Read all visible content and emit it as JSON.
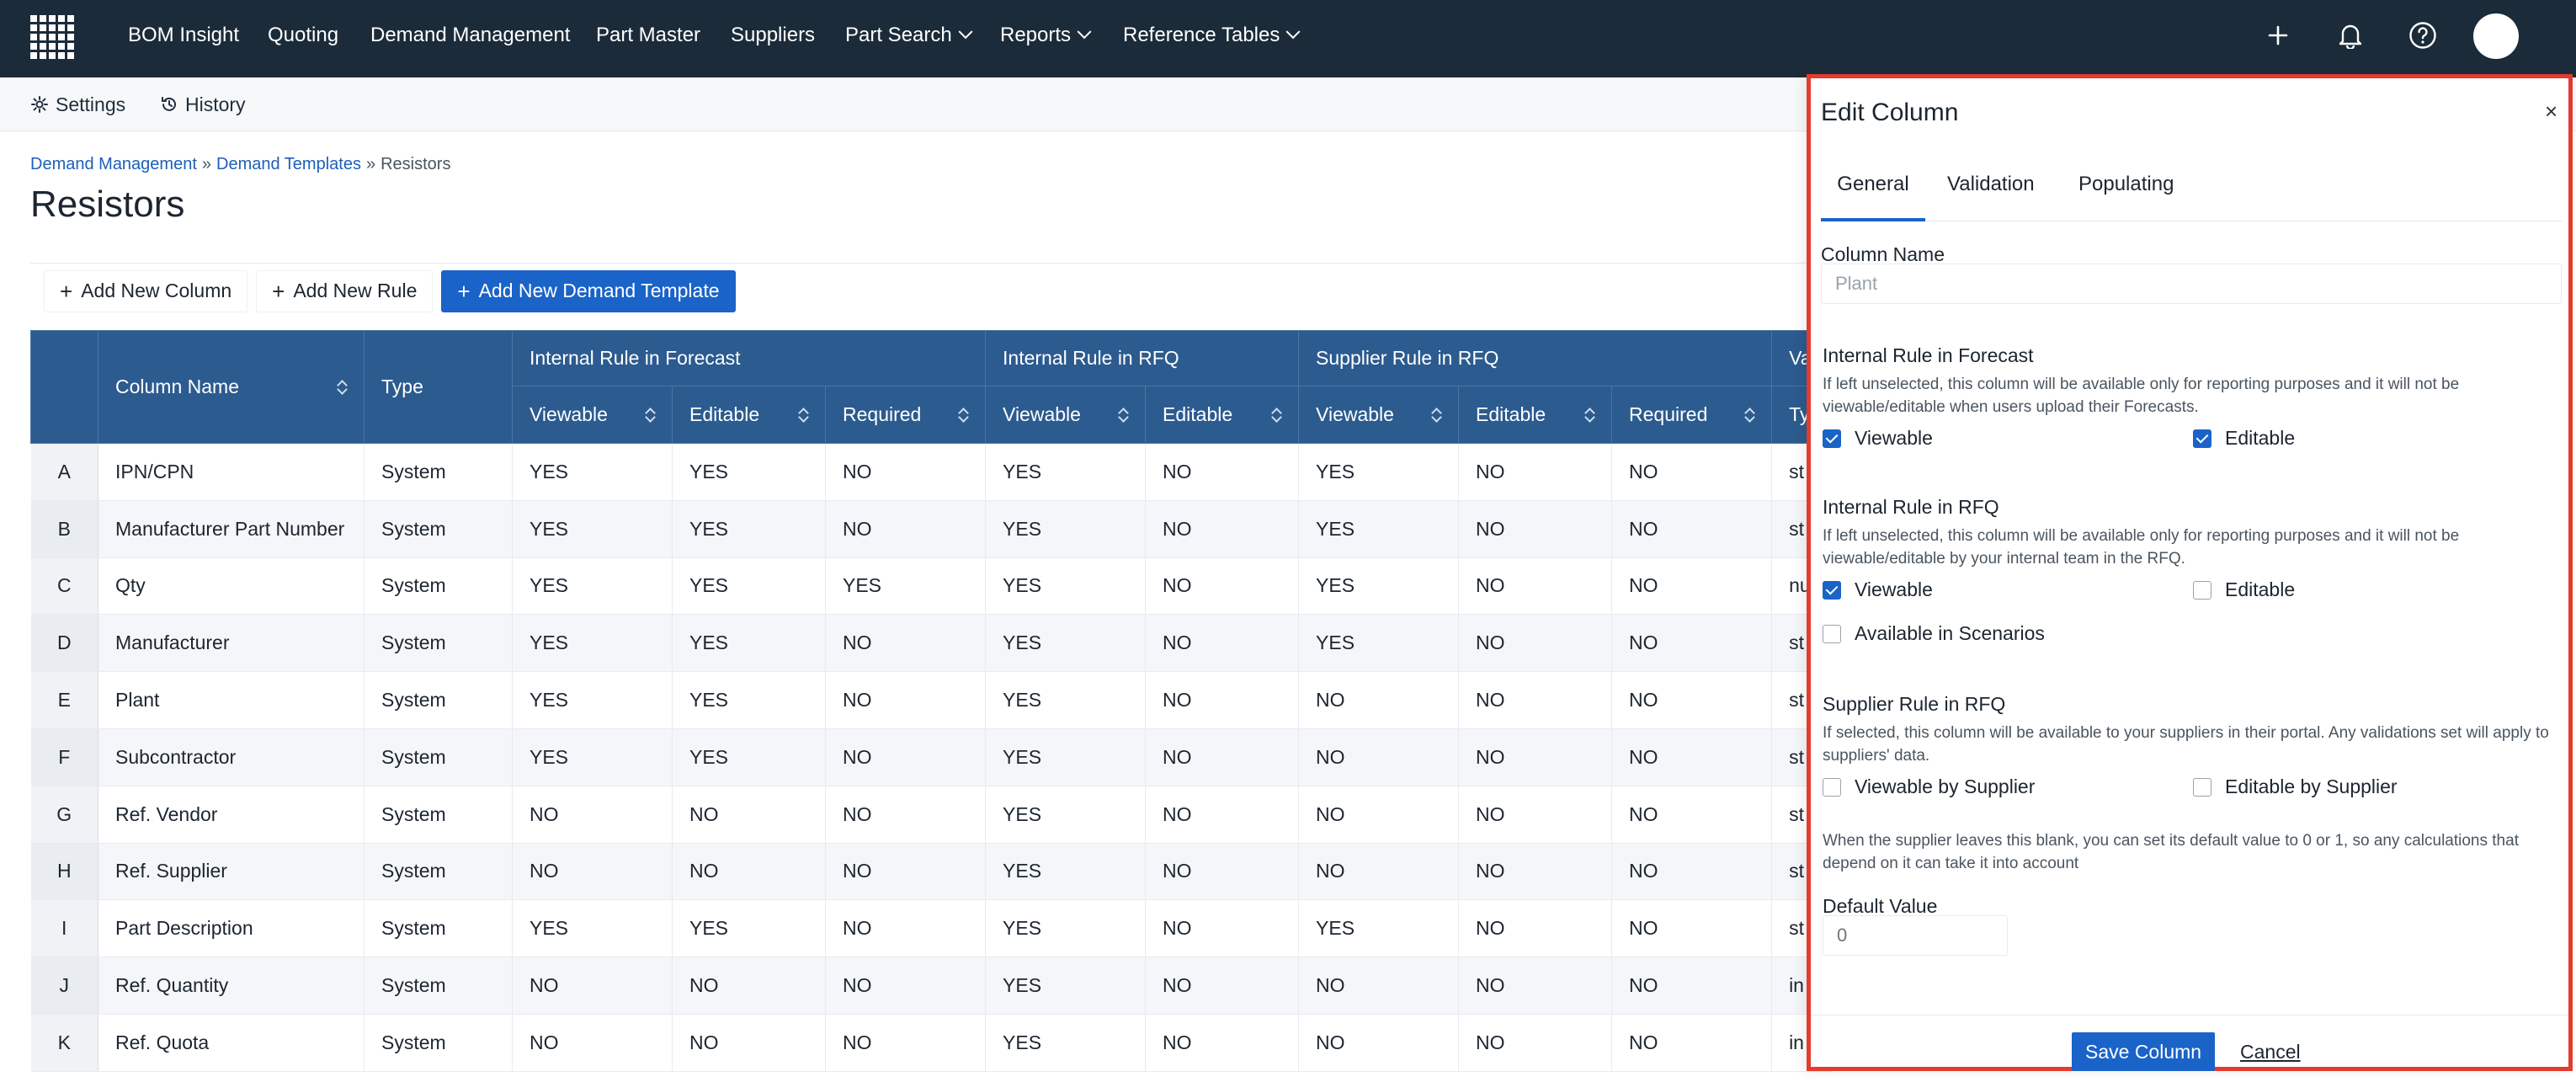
{
  "nav": {
    "items": [
      "BOM Insight",
      "Quoting",
      "Demand Management",
      "Part Master",
      "Suppliers",
      "Part Search",
      "Reports",
      "Reference Tables"
    ]
  },
  "subbar": {
    "settings": "Settings",
    "history": "History"
  },
  "breadcrumb": {
    "level1": "Demand Management",
    "sep": "»",
    "level2": "Demand Templates",
    "current": "Resistors"
  },
  "page": {
    "title": "Resistors"
  },
  "toolbar": {
    "add_column": "Add New Column",
    "add_rule": "Add New Rule",
    "add_template": "Add New Demand Template",
    "plus": "+"
  },
  "table": {
    "headers": {
      "column_name": "Column Name",
      "type": "Type",
      "internal_forecast": "Internal Rule in Forecast",
      "internal_rfq": "Internal Rule in RFQ",
      "supplier_rfq": "Supplier Rule in RFQ",
      "validation_partial": "Va",
      "viewable": "Viewable",
      "editable": "Editable",
      "required": "Required",
      "type_partial": "Ty"
    },
    "rows": [
      [
        "A",
        "IPN/CPN",
        "System",
        "YES",
        "YES",
        "NO",
        "YES",
        "NO",
        "YES",
        "NO",
        "NO",
        "st"
      ],
      [
        "B",
        "Manufacturer Part Number",
        "System",
        "YES",
        "YES",
        "NO",
        "YES",
        "NO",
        "YES",
        "NO",
        "NO",
        "st"
      ],
      [
        "C",
        "Qty",
        "System",
        "YES",
        "YES",
        "YES",
        "YES",
        "NO",
        "YES",
        "NO",
        "NO",
        "nu"
      ],
      [
        "D",
        "Manufacturer",
        "System",
        "YES",
        "YES",
        "NO",
        "YES",
        "NO",
        "YES",
        "NO",
        "NO",
        "st"
      ],
      [
        "E",
        "Plant",
        "System",
        "YES",
        "YES",
        "NO",
        "YES",
        "NO",
        "NO",
        "NO",
        "NO",
        "st"
      ],
      [
        "F",
        "Subcontractor",
        "System",
        "YES",
        "YES",
        "NO",
        "YES",
        "NO",
        "NO",
        "NO",
        "NO",
        "st"
      ],
      [
        "G",
        "Ref. Vendor",
        "System",
        "NO",
        "NO",
        "NO",
        "YES",
        "NO",
        "NO",
        "NO",
        "NO",
        "st"
      ],
      [
        "H",
        "Ref. Supplier",
        "System",
        "NO",
        "NO",
        "NO",
        "YES",
        "NO",
        "NO",
        "NO",
        "NO",
        "st"
      ],
      [
        "I",
        "Part Description",
        "System",
        "YES",
        "YES",
        "NO",
        "YES",
        "NO",
        "YES",
        "NO",
        "NO",
        "st"
      ],
      [
        "J",
        "Ref. Quantity",
        "System",
        "NO",
        "NO",
        "NO",
        "YES",
        "NO",
        "NO",
        "NO",
        "NO",
        "in"
      ],
      [
        "K",
        "Ref. Quota",
        "System",
        "NO",
        "NO",
        "NO",
        "YES",
        "NO",
        "NO",
        "NO",
        "NO",
        "in"
      ]
    ]
  },
  "drawer": {
    "title": "Edit Column",
    "close": "×",
    "tabs": [
      "General",
      "Validation",
      "Populating"
    ],
    "column_name_label": "Column Name",
    "column_name_value": "Plant",
    "forecast": {
      "title": "Internal Rule in Forecast",
      "help": "If left unselected, this column will be available only for reporting purposes and it will not be viewable/editable when users upload their Forecasts.",
      "viewable": "Viewable",
      "viewable_checked": true,
      "editable": "Editable",
      "editable_checked": true
    },
    "rfq": {
      "title": "Internal Rule in RFQ",
      "help": "If left unselected, this column will be available only for reporting purposes and it will not be viewable/editable by your internal team in the RFQ.",
      "viewable": "Viewable",
      "viewable_checked": true,
      "editable": "Editable",
      "editable_checked": false,
      "scenarios": "Available in Scenarios",
      "scenarios_checked": false
    },
    "supplier": {
      "title": "Supplier Rule in RFQ",
      "help": "If selected, this column will be available to your suppliers in their portal. Any validations set will apply to suppliers' data.",
      "viewable": "Viewable by Supplier",
      "viewable_checked": false,
      "editable": "Editable by Supplier",
      "editable_checked": false,
      "default_help": "When the supplier leaves this blank, you can set its default value to 0 or 1, so any calculations that depend on it can take it into account",
      "default_label": "Default Value",
      "default_placeholder": "0"
    },
    "save": "Save Column",
    "cancel": "Cancel"
  },
  "colors": {
    "nav_bg": "#1c2b3a",
    "header_bg": "#2c5b8f",
    "accent": "#1a63c8",
    "highlight_border": "#e33b2e"
  }
}
